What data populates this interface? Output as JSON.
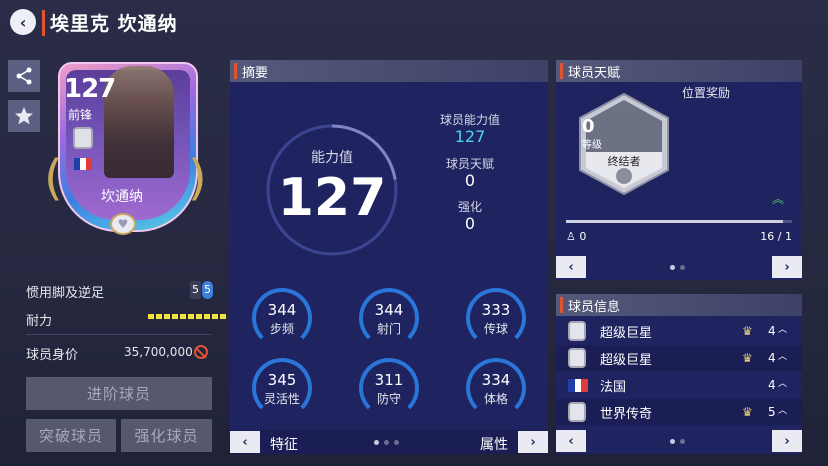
{
  "header": {
    "title": "埃里克 坎通纳"
  },
  "card": {
    "rating": "127",
    "position": "前锋",
    "name": "坎通纳",
    "flag_colors": [
      "#1f3fa6",
      "#ffffff",
      "#e03a3a"
    ]
  },
  "left_info": {
    "weak_foot_label": "惯用脚及逆足",
    "weak_foot_values": [
      "5",
      "5"
    ],
    "stamina_label": "耐力",
    "stamina_bars": 10,
    "value_label": "球员身价",
    "value": "35,700,000",
    "buttons": {
      "advance": "进阶球员",
      "breakthrough": "突破球员",
      "enhance": "强化球员"
    }
  },
  "summary": {
    "title": "摘要",
    "ability_label": "能力值",
    "ability_value": "127",
    "player_ability_label": "球员能力值",
    "player_ability_value": "127",
    "talent_label": "球员天赋",
    "talent_value": "0",
    "enhance_label": "强化",
    "enhance_value": "0",
    "stats": [
      {
        "label": "步频",
        "value": "344"
      },
      {
        "label": "射门",
        "value": "344"
      },
      {
        "label": "传球",
        "value": "333"
      },
      {
        "label": "灵活性",
        "value": "345"
      },
      {
        "label": "防守",
        "value": "311"
      },
      {
        "label": "体格",
        "value": "334"
      }
    ],
    "footer_left": "特征",
    "footer_right": "属性"
  },
  "talent": {
    "title": "球员天赋",
    "bonus_label": "位置奖励",
    "level_value": "0",
    "level_label": "等级",
    "skill_name": "终结者",
    "progress_left": "0",
    "progress_right": "16 / 1"
  },
  "info": {
    "title": "球员信息",
    "rows": [
      {
        "name": "超级巨星",
        "count": "4",
        "crown": true
      },
      {
        "name": "超级巨星",
        "count": "4",
        "crown": true
      },
      {
        "name": "法国",
        "count": "4",
        "crown": false
      },
      {
        "name": "世界传奇",
        "count": "5",
        "crown": true
      }
    ]
  },
  "colors": {
    "accent": "#e2532f",
    "panel": "#1f2461",
    "ring": "#2a75d8",
    "cyan": "#4fd3e8"
  }
}
